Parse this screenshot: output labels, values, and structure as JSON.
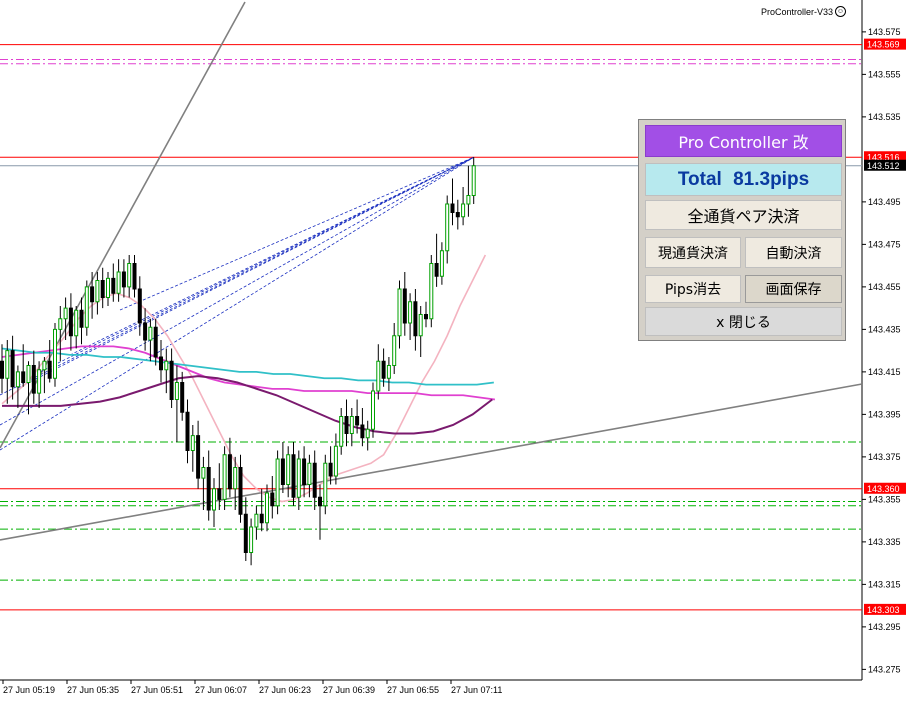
{
  "indicator_label": "ProController-V33",
  "panel": {
    "title": "Pro Controller 改",
    "total": "Total 81.3pips",
    "close_all": "全通貨ペア決済",
    "close_current": "現通貨決済",
    "auto_close": "自動決済",
    "pips_clear": "Pips消去",
    "save_screen": "画面保存",
    "close": "x 閉じる"
  },
  "colors": {
    "bull": "#00a000",
    "bear": "#000000",
    "ma_pink": "#f4b3c0",
    "ma_magenta": "#e040d0",
    "ma_cyan": "#30c0c8",
    "ma_purple": "#7a1a6e",
    "level_red": "#ff0000",
    "level_green": "#00b000",
    "trend_gray": "#808080",
    "fan_blue": "#1a2fc0",
    "panel_title": "#a24fe6",
    "panel_total": "#b7e9ee"
  },
  "chart_data": {
    "type": "candlestick",
    "symbol_timeframe": "M1",
    "ylim": [
      143.27,
      143.59
    ],
    "y_ticks": [
      "143.575",
      "143.555",
      "143.535",
      "143.516",
      "143.512",
      "143.495",
      "143.475",
      "143.455",
      "143.435",
      "143.415",
      "143.395",
      "143.375",
      "143.360",
      "143.355",
      "143.335",
      "143.315",
      "143.303",
      "143.295",
      "143.275",
      "143.569"
    ],
    "axis_labels": [
      {
        "value": 143.575,
        "text": "143.575"
      },
      {
        "value": 143.555,
        "text": "143.555"
      },
      {
        "value": 143.535,
        "text": "143.535"
      },
      {
        "value": 143.495,
        "text": "143.495"
      },
      {
        "value": 143.475,
        "text": "143.475"
      },
      {
        "value": 143.455,
        "text": "143.455"
      },
      {
        "value": 143.435,
        "text": "143.435"
      },
      {
        "value": 143.415,
        "text": "143.415"
      },
      {
        "value": 143.395,
        "text": "143.395"
      },
      {
        "value": 143.375,
        "text": "143.375"
      },
      {
        "value": 143.355,
        "text": "143.355"
      },
      {
        "value": 143.335,
        "text": "143.335"
      },
      {
        "value": 143.315,
        "text": "143.315"
      },
      {
        "value": 143.295,
        "text": "143.295"
      },
      {
        "value": 143.275,
        "text": "143.275"
      }
    ],
    "highlight_labels": [
      {
        "value": 143.569,
        "text": "143.569",
        "style": "red"
      },
      {
        "value": 143.516,
        "text": "143.516",
        "style": "red"
      },
      {
        "value": 143.512,
        "text": "143.512",
        "style": "black"
      },
      {
        "value": 143.36,
        "text": "143.360",
        "style": "red"
      },
      {
        "value": 143.303,
        "text": "143.303",
        "style": "red"
      }
    ],
    "x_ticks": [
      "27 Jun 05:19",
      "27 Jun 05:35",
      "27 Jun 05:51",
      "27 Jun 06:07",
      "27 Jun 06:23",
      "27 Jun 06:39",
      "27 Jun 06:55",
      "27 Jun 07:11"
    ],
    "red_levels": [
      143.569,
      143.516,
      143.36,
      143.303
    ],
    "green_dashed_levels": [
      143.382,
      143.354,
      143.352,
      143.341,
      143.317
    ],
    "magenta_dashed_levels": [
      143.562,
      143.56
    ],
    "bid_line": 143.512,
    "candles": [
      {
        "o": 143.42,
        "h": 143.428,
        "l": 143.405,
        "c": 143.412
      },
      {
        "o": 143.412,
        "h": 143.43,
        "l": 143.4,
        "c": 143.425
      },
      {
        "o": 143.425,
        "h": 143.432,
        "l": 143.402,
        "c": 143.408
      },
      {
        "o": 143.408,
        "h": 143.418,
        "l": 143.398,
        "c": 143.415
      },
      {
        "o": 143.415,
        "h": 143.428,
        "l": 143.408,
        "c": 143.41
      },
      {
        "o": 143.41,
        "h": 143.42,
        "l": 143.395,
        "c": 143.418
      },
      {
        "o": 143.418,
        "h": 143.425,
        "l": 143.4,
        "c": 143.405
      },
      {
        "o": 143.405,
        "h": 143.42,
        "l": 143.398,
        "c": 143.416
      },
      {
        "o": 143.416,
        "h": 143.422,
        "l": 143.405,
        "c": 143.42
      },
      {
        "o": 143.42,
        "h": 143.43,
        "l": 143.41,
        "c": 143.412
      },
      {
        "o": 143.412,
        "h": 143.438,
        "l": 143.408,
        "c": 143.435
      },
      {
        "o": 143.435,
        "h": 143.446,
        "l": 143.42,
        "c": 143.44
      },
      {
        "o": 143.44,
        "h": 143.45,
        "l": 143.43,
        "c": 143.445
      },
      {
        "o": 143.445,
        "h": 143.452,
        "l": 143.425,
        "c": 143.432
      },
      {
        "o": 143.432,
        "h": 143.446,
        "l": 143.426,
        "c": 143.444
      },
      {
        "o": 143.444,
        "h": 143.45,
        "l": 143.428,
        "c": 143.436
      },
      {
        "o": 143.436,
        "h": 143.458,
        "l": 143.432,
        "c": 143.455
      },
      {
        "o": 143.455,
        "h": 143.462,
        "l": 143.44,
        "c": 143.448
      },
      {
        "o": 143.448,
        "h": 143.462,
        "l": 143.442,
        "c": 143.458
      },
      {
        "o": 143.458,
        "h": 143.464,
        "l": 143.445,
        "c": 143.45
      },
      {
        "o": 143.45,
        "h": 143.462,
        "l": 143.446,
        "c": 143.459
      },
      {
        "o": 143.459,
        "h": 143.466,
        "l": 143.448,
        "c": 143.452
      },
      {
        "o": 143.452,
        "h": 143.468,
        "l": 143.448,
        "c": 143.462
      },
      {
        "o": 143.462,
        "h": 143.468,
        "l": 143.45,
        "c": 143.455
      },
      {
        "o": 143.455,
        "h": 143.47,
        "l": 143.45,
        "c": 143.466
      },
      {
        "o": 143.466,
        "h": 143.47,
        "l": 143.45,
        "c": 143.454
      },
      {
        "o": 143.454,
        "h": 143.46,
        "l": 143.432,
        "c": 143.438
      },
      {
        "o": 143.438,
        "h": 143.445,
        "l": 143.425,
        "c": 143.43
      },
      {
        "o": 143.43,
        "h": 143.44,
        "l": 143.42,
        "c": 143.436
      },
      {
        "o": 143.436,
        "h": 143.44,
        "l": 143.418,
        "c": 143.422
      },
      {
        "o": 143.422,
        "h": 143.43,
        "l": 143.41,
        "c": 143.416
      },
      {
        "o": 143.416,
        "h": 143.426,
        "l": 143.405,
        "c": 143.42
      },
      {
        "o": 143.42,
        "h": 143.426,
        "l": 143.398,
        "c": 143.402
      },
      {
        "o": 143.402,
        "h": 143.418,
        "l": 143.382,
        "c": 143.41
      },
      {
        "o": 143.41,
        "h": 143.415,
        "l": 143.392,
        "c": 143.396
      },
      {
        "o": 143.396,
        "h": 143.402,
        "l": 143.372,
        "c": 143.378
      },
      {
        "o": 143.378,
        "h": 143.39,
        "l": 143.368,
        "c": 143.385
      },
      {
        "o": 143.385,
        "h": 143.392,
        "l": 143.36,
        "c": 143.365
      },
      {
        "o": 143.365,
        "h": 143.375,
        "l": 143.35,
        "c": 143.37
      },
      {
        "o": 143.37,
        "h": 143.378,
        "l": 143.345,
        "c": 143.35
      },
      {
        "o": 143.35,
        "h": 143.365,
        "l": 143.342,
        "c": 143.36
      },
      {
        "o": 143.36,
        "h": 143.372,
        "l": 143.35,
        "c": 143.355
      },
      {
        "o": 143.355,
        "h": 143.38,
        "l": 143.35,
        "c": 143.376
      },
      {
        "o": 143.376,
        "h": 143.384,
        "l": 143.356,
        "c": 143.36
      },
      {
        "o": 143.36,
        "h": 143.375,
        "l": 143.35,
        "c": 143.37
      },
      {
        "o": 143.37,
        "h": 143.376,
        "l": 143.344,
        "c": 143.348
      },
      {
        "o": 143.348,
        "h": 143.356,
        "l": 143.326,
        "c": 143.33
      },
      {
        "o": 143.33,
        "h": 143.346,
        "l": 143.324,
        "c": 143.342
      },
      {
        "o": 143.342,
        "h": 143.352,
        "l": 143.336,
        "c": 143.348
      },
      {
        "o": 143.348,
        "h": 143.36,
        "l": 143.34,
        "c": 143.344
      },
      {
        "o": 143.344,
        "h": 143.362,
        "l": 143.34,
        "c": 143.358
      },
      {
        "o": 143.358,
        "h": 143.366,
        "l": 143.346,
        "c": 143.352
      },
      {
        "o": 143.352,
        "h": 143.378,
        "l": 143.348,
        "c": 143.374
      },
      {
        "o": 143.374,
        "h": 143.382,
        "l": 143.358,
        "c": 143.362
      },
      {
        "o": 143.362,
        "h": 143.38,
        "l": 143.356,
        "c": 143.376
      },
      {
        "o": 143.376,
        "h": 143.382,
        "l": 143.352,
        "c": 143.356
      },
      {
        "o": 143.356,
        "h": 143.378,
        "l": 143.35,
        "c": 143.374
      },
      {
        "o": 143.374,
        "h": 143.38,
        "l": 143.356,
        "c": 143.362
      },
      {
        "o": 143.362,
        "h": 143.376,
        "l": 143.356,
        "c": 143.372
      },
      {
        "o": 143.372,
        "h": 143.378,
        "l": 143.35,
        "c": 143.356
      },
      {
        "o": 143.356,
        "h": 143.362,
        "l": 143.336,
        "c": 143.352
      },
      {
        "o": 143.352,
        "h": 143.376,
        "l": 143.348,
        "c": 143.372
      },
      {
        "o": 143.372,
        "h": 143.38,
        "l": 143.362,
        "c": 143.366
      },
      {
        "o": 143.366,
        "h": 143.386,
        "l": 143.362,
        "c": 143.38
      },
      {
        "o": 143.38,
        "h": 143.398,
        "l": 143.376,
        "c": 143.394
      },
      {
        "o": 143.394,
        "h": 143.402,
        "l": 143.38,
        "c": 143.386
      },
      {
        "o": 143.386,
        "h": 143.398,
        "l": 143.38,
        "c": 143.394
      },
      {
        "o": 143.394,
        "h": 143.402,
        "l": 143.386,
        "c": 143.39
      },
      {
        "o": 143.39,
        "h": 143.398,
        "l": 143.38,
        "c": 143.384
      },
      {
        "o": 143.384,
        "h": 143.392,
        "l": 143.378,
        "c": 143.388
      },
      {
        "o": 143.388,
        "h": 143.41,
        "l": 143.384,
        "c": 143.406
      },
      {
        "o": 143.406,
        "h": 143.428,
        "l": 143.402,
        "c": 143.42
      },
      {
        "o": 143.42,
        "h": 143.426,
        "l": 143.408,
        "c": 143.412
      },
      {
        "o": 143.412,
        "h": 143.422,
        "l": 143.406,
        "c": 143.418
      },
      {
        "o": 143.418,
        "h": 143.438,
        "l": 143.414,
        "c": 143.432
      },
      {
        "o": 143.432,
        "h": 143.458,
        "l": 143.426,
        "c": 143.454
      },
      {
        "o": 143.454,
        "h": 143.462,
        "l": 143.432,
        "c": 143.438
      },
      {
        "o": 143.438,
        "h": 143.452,
        "l": 143.43,
        "c": 143.448
      },
      {
        "o": 143.448,
        "h": 143.454,
        "l": 143.425,
        "c": 143.432
      },
      {
        "o": 143.432,
        "h": 143.446,
        "l": 143.422,
        "c": 143.442
      },
      {
        "o": 143.442,
        "h": 143.448,
        "l": 143.436,
        "c": 143.44
      },
      {
        "o": 143.44,
        "h": 143.47,
        "l": 143.436,
        "c": 143.466
      },
      {
        "o": 143.466,
        "h": 143.48,
        "l": 143.455,
        "c": 143.46
      },
      {
        "o": 143.46,
        "h": 143.476,
        "l": 143.456,
        "c": 143.472
      },
      {
        "o": 143.472,
        "h": 143.498,
        "l": 143.466,
        "c": 143.494
      },
      {
        "o": 143.494,
        "h": 143.506,
        "l": 143.484,
        "c": 143.49
      },
      {
        "o": 143.49,
        "h": 143.496,
        "l": 143.482,
        "c": 143.488
      },
      {
        "o": 143.488,
        "h": 143.502,
        "l": 143.484,
        "c": 143.494
      },
      {
        "o": 143.494,
        "h": 143.512,
        "l": 143.488,
        "c": 143.498
      },
      {
        "o": 143.498,
        "h": 143.516,
        "l": 143.494,
        "c": 143.512
      }
    ],
    "ma_pink": [
      143.4,
      143.405,
      143.41,
      143.418,
      143.425,
      143.432,
      143.44,
      143.446,
      143.45,
      143.452,
      143.45,
      143.446,
      143.44,
      143.432,
      143.422,
      143.412,
      143.4,
      143.388,
      143.376,
      143.366,
      143.36,
      143.356,
      143.354,
      143.355,
      143.358,
      143.362,
      143.366,
      143.368,
      143.37,
      143.372,
      143.376,
      143.386,
      143.398,
      143.41,
      143.42,
      143.432,
      143.446,
      143.458,
      143.47
    ],
    "ma_magenta": [
      143.422,
      143.423,
      143.424,
      143.425,
      143.426,
      143.427,
      143.427,
      143.427,
      143.426,
      143.424,
      143.421,
      143.418,
      143.415,
      143.412,
      143.41,
      143.409,
      143.408,
      143.407,
      143.407,
      143.406,
      143.406,
      143.406,
      143.406,
      143.405,
      143.405,
      143.405,
      143.405,
      143.404,
      143.404,
      143.404,
      143.403,
      143.402
    ],
    "ma_cyan": [
      143.426,
      143.425,
      143.424,
      143.424,
      143.423,
      143.423,
      143.422,
      143.422,
      143.421,
      143.42,
      143.419,
      143.418,
      143.417,
      143.416,
      143.415,
      143.415,
      143.414,
      143.414,
      143.413,
      143.412,
      143.412,
      143.411,
      143.411,
      143.41,
      143.41,
      143.409,
      143.409,
      143.409,
      143.409,
      143.41
    ],
    "ma_purple": [
      143.399,
      143.399,
      143.399,
      143.399,
      143.4,
      143.401,
      143.403,
      143.406,
      143.409,
      143.412,
      143.413,
      143.412,
      143.41,
      143.407,
      143.404,
      143.4,
      143.396,
      143.392,
      143.389,
      143.387,
      143.386,
      143.386,
      143.387,
      143.39,
      143.395,
      143.402
    ]
  }
}
